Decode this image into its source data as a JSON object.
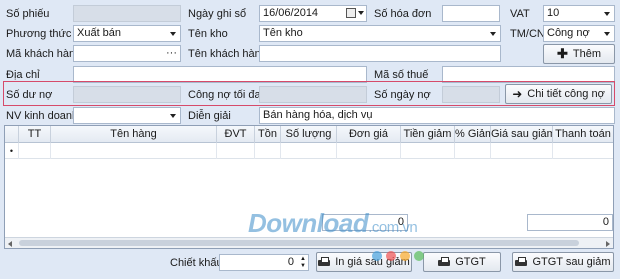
{
  "form": {
    "so_phieu_label": "Số phiếu",
    "so_phieu_value": "",
    "ngay_ghi_so_label": "Ngày ghi sổ",
    "ngay_ghi_so_value": "16/06/2014",
    "so_hoa_don_label": "Số hóa đơn",
    "so_hoa_don_value": "",
    "vat_label": "VAT",
    "vat_value": "10",
    "phuong_thuc_label": "Phương thức",
    "phuong_thuc_value": "Xuất bán",
    "ten_kho_label": "Tên kho",
    "ten_kho_value": "Tên kho",
    "tmcn_label": "TM/CN",
    "tmcn_value": "Công nợ",
    "ma_khach_hang_label": "Mã khách hàng",
    "ma_khach_hang_value": "",
    "ellipsis": "···",
    "ten_khach_hang_label": "Tên khách hàng",
    "ten_khach_hang_value": "",
    "them_button": "Thêm",
    "dia_chi_label": "Địa chỉ",
    "dia_chi_value": "",
    "ma_so_thue_label": "Mã số thuế",
    "ma_so_thue_value": "",
    "so_du_no_label": "Số dư nợ",
    "cong_no_toi_da_label": "Công nợ tối đa",
    "so_ngay_no_label": "Số ngày nợ",
    "chi_tiet_cong_no_button": "Chi tiết công nợ",
    "nv_kinh_doanh_label": "NV kinh doanh",
    "nv_kinh_doanh_value": "",
    "dien_giai_label": "Diễn giải",
    "dien_giai_value": "Bán hàng hóa, dịch vụ"
  },
  "grid": {
    "columns": [
      "TT",
      "Tên hàng",
      "ĐVT",
      "Tồn",
      "Số lượng",
      "Đơn giá",
      "Tiền giảm",
      "% Giảm",
      "Giá sau giảm",
      "Thanh toán"
    ],
    "row_marker": "•",
    "total_left": "0",
    "total_right": "0"
  },
  "footer": {
    "chiet_khau_label": "Chiết khấu",
    "chiet_khau_value": "0",
    "in_gia_sau_giam_button": "In giá sau giảm",
    "gtgt_button": "GTGT",
    "gtgt_sau_giam_button": "GTGT sau giảm"
  },
  "watermark": {
    "brand": "Download",
    "domain": ".com.vn"
  }
}
